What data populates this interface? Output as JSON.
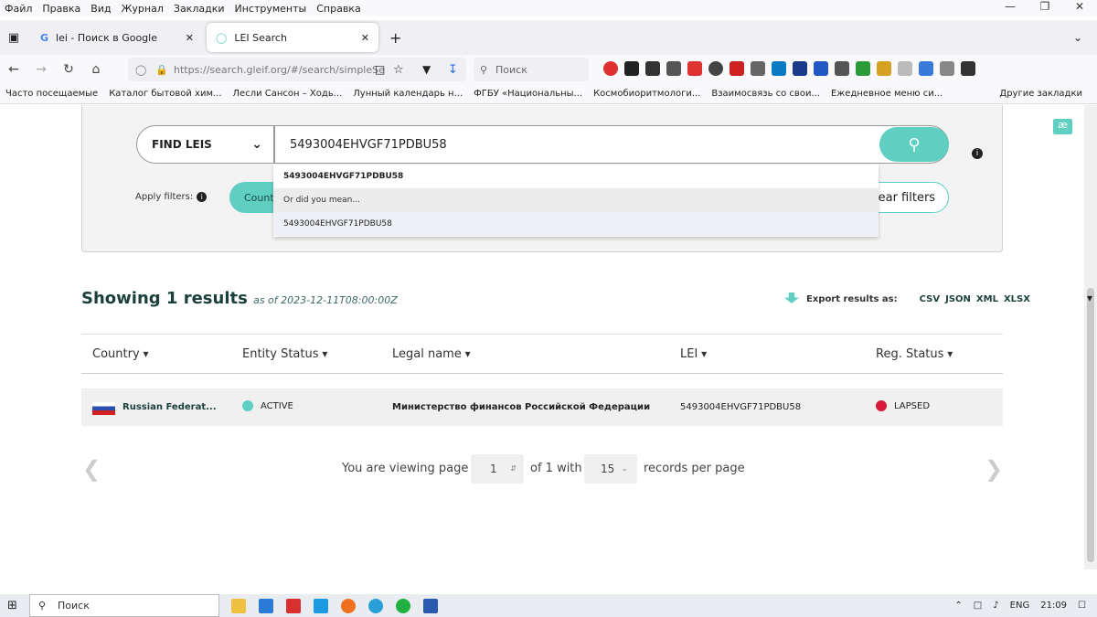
{
  "menu": {
    "items": [
      "Файл",
      "Правка",
      "Вид",
      "Журнал",
      "Закладки",
      "Инструменты",
      "Справка"
    ]
  },
  "tabs": [
    {
      "title": "lei - Поиск в Google"
    },
    {
      "title": "LEI Search"
    }
  ],
  "navbar": {
    "url": "https://search.gleif.org/#/search/simpleSe",
    "search_placeholder": "Поиск"
  },
  "bookmarks": [
    "Часто посещаемые",
    "Каталог бытовой хим...",
    "Лесли Сансон – Ходь...",
    "Лунный календарь н...",
    "ФГБУ «Национальны...",
    "Космобиоритмологи...",
    "Взаимосвязь со свои...",
    "Ежедневное меню си...",
    "Другие закладки"
  ],
  "search": {
    "mode": "FIND LEIS",
    "query": "5493004EHVGF71PDBU58",
    "apply_filters": "Apply filters:",
    "country_filter": "Country",
    "clear_filters": "lear filters"
  },
  "suggestions": {
    "first": "5493004EHVGF71PDBU58",
    "hint": "Or did you mean...",
    "second": "5493004EHVGF71PDBU58"
  },
  "results": {
    "showing_label": "Showing 1 results",
    "as_of": "as of 2023-12-11T08:00:00Z",
    "export_label": "Export results as:",
    "formats": [
      "CSV",
      "JSON",
      "XML",
      "XLSX"
    ]
  },
  "table": {
    "headers": [
      "Country",
      "Entity Status",
      "Legal name",
      "LEI",
      "Reg. Status"
    ],
    "rows": [
      {
        "country": "Russian Federat...",
        "entity_status": "ACTIVE",
        "legal_name": "Министерство финансов Российской Федерации",
        "lei": "5493004EHVGF71PDBU58",
        "reg_status": "LAPSED"
      }
    ]
  },
  "pager": {
    "prefix": "You are viewing page",
    "page": "1",
    "middle": "of 1 with",
    "per_page": "15",
    "suffix": "records per page"
  },
  "taskbar": {
    "search": "Поиск",
    "lang": "ENG",
    "time": "21:09"
  },
  "colors": {
    "accent": "#5ecfc1",
    "active": "#5ecfc1",
    "lapsed": "#d8183a"
  }
}
